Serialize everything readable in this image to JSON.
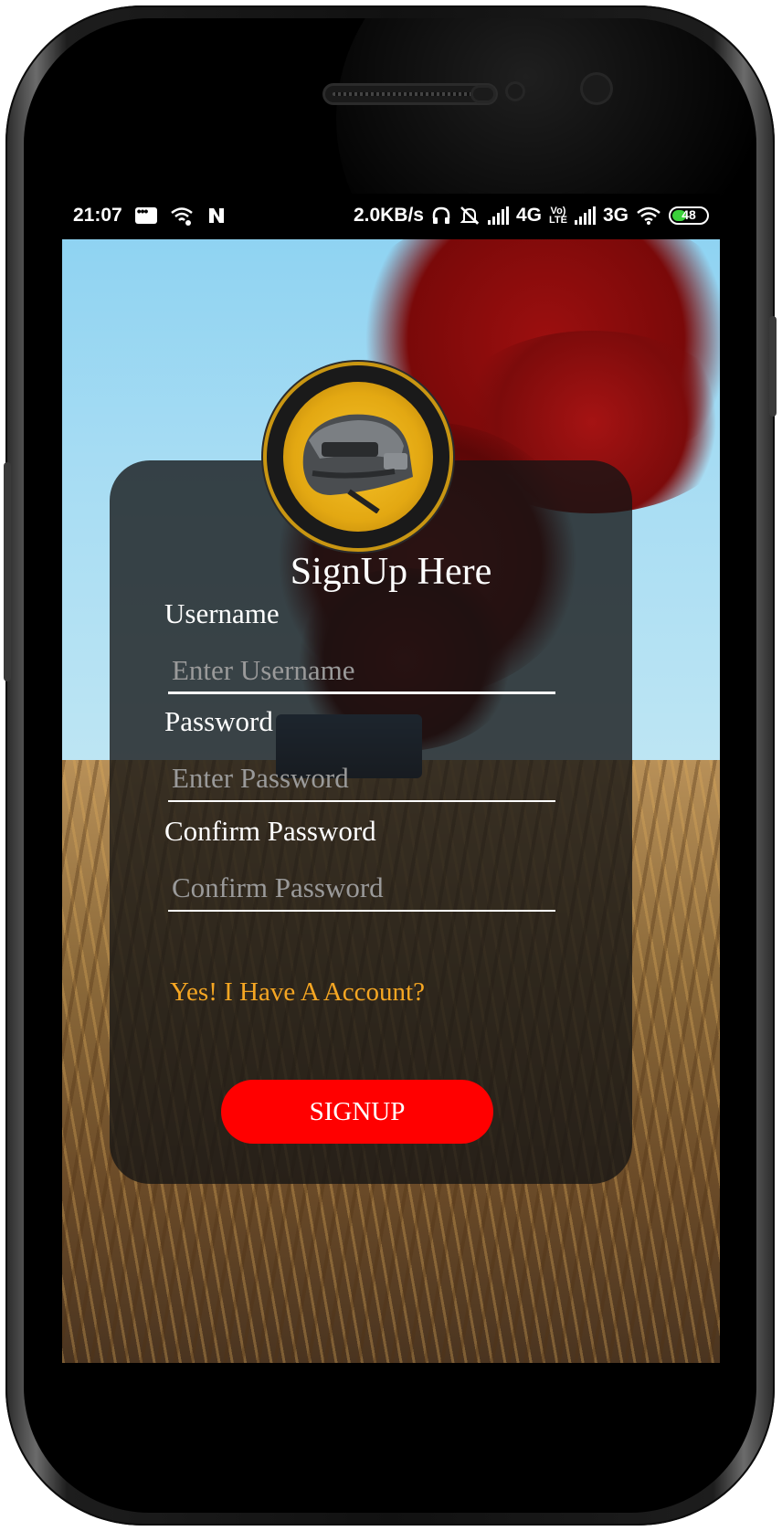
{
  "statusbar": {
    "time": "21:07",
    "network_speed": "2.0KB/s",
    "network_4g": "4G",
    "volte": "Vo)\nLTE",
    "network_3g": "3G",
    "battery_level": "48",
    "icons": [
      "message-icon",
      "wifi-calling-icon",
      "nfc-icon",
      "headphones-icon",
      "mute-icon",
      "signal-icon",
      "signal-icon-2",
      "wifi-icon",
      "battery-icon"
    ]
  },
  "form": {
    "title": "SignUp Here",
    "username_label": "Username",
    "username_placeholder": "Enter Username",
    "username_value": "",
    "password_label": "Password",
    "password_placeholder": "Enter Password",
    "password_value": "",
    "confirm_label": "Confirm Password",
    "confirm_placeholder": "Confirm Password",
    "confirm_value": "",
    "login_link": "Yes! I Have A Account?",
    "submit_label": "SIGNUP"
  },
  "colors": {
    "accent": "#f5a623",
    "button": "#ff0000",
    "card": "#141414"
  }
}
